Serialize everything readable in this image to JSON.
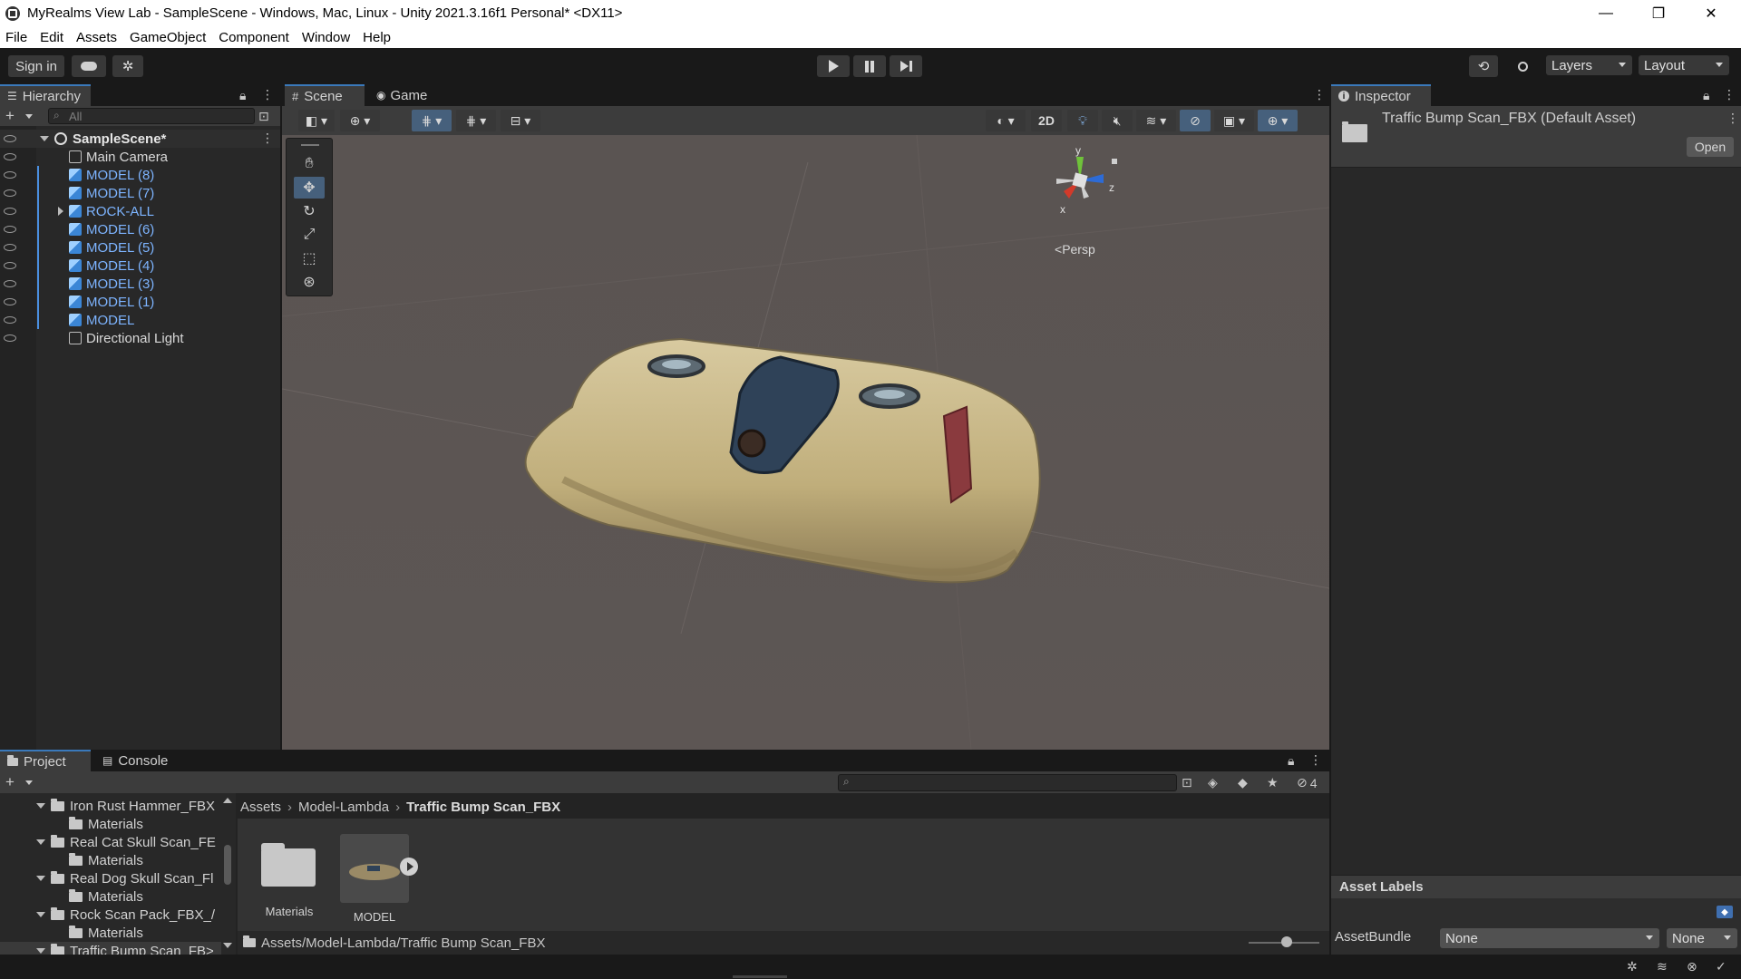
{
  "window": {
    "title": "MyRealms View Lab - SampleScene - Windows, Mac, Linux - Unity 2021.3.16f1 Personal* <DX11>",
    "minimize": "—",
    "restore": "❐",
    "close": "✕"
  },
  "menu": [
    "File",
    "Edit",
    "Assets",
    "GameObject",
    "Component",
    "Window",
    "Help"
  ],
  "toolbar": {
    "sign_in": "Sign in",
    "layers": "Layers",
    "layout": "Layout"
  },
  "hierarchy": {
    "tab": "Hierarchy",
    "search_placeholder": "All",
    "scene": "SampleScene*",
    "items": [
      {
        "label": "Main Camera",
        "type": "gray"
      },
      {
        "label": "MODEL (8)",
        "type": "blue"
      },
      {
        "label": "MODEL (7)",
        "type": "blue"
      },
      {
        "label": "ROCK-ALL",
        "type": "blue"
      },
      {
        "label": "MODEL (6)",
        "type": "blue"
      },
      {
        "label": "MODEL (5)",
        "type": "blue"
      },
      {
        "label": "MODEL (4)",
        "type": "blue"
      },
      {
        "label": "MODEL (3)",
        "type": "blue"
      },
      {
        "label": "MODEL (1)",
        "type": "blue"
      },
      {
        "label": "MODEL",
        "type": "blue"
      },
      {
        "label": "Directional Light",
        "type": "gray"
      }
    ]
  },
  "scene": {
    "tabs": [
      "Scene",
      "Game"
    ],
    "btn_2d": "2D",
    "persp": "Persp",
    "gizmo_axes": {
      "y": "y",
      "z": "z",
      "x": "x"
    }
  },
  "inspector": {
    "tab": "Inspector",
    "asset_title": "Traffic Bump Scan_FBX (Default Asset)",
    "open": "Open",
    "asset_labels": "Asset Labels",
    "assetbundle_label": "AssetBundle",
    "assetbundle_value": "None",
    "variant_value": "None"
  },
  "project": {
    "tabs": [
      "Project",
      "Console"
    ],
    "hidden_count": "4",
    "breadcrumb": [
      "Assets",
      "Model-Lambda",
      "Traffic Bump Scan_FBX"
    ],
    "tree": [
      {
        "label": "Iron Rust Hammer_FBX",
        "child": "Materials"
      },
      {
        "label": "Real Cat Skull Scan_FE",
        "child": "Materials"
      },
      {
        "label": "Real Dog Skull Scan_Fl",
        "child": "Materials"
      },
      {
        "label": "Rock Scan Pack_FBX_/",
        "child": "Materials"
      },
      {
        "label": "Traffic Bump Scan_FB>",
        "child": null
      }
    ],
    "assets": [
      "Materials",
      "MODEL"
    ],
    "path": "Assets/Model-Lambda/Traffic Bump Scan_FBX"
  }
}
